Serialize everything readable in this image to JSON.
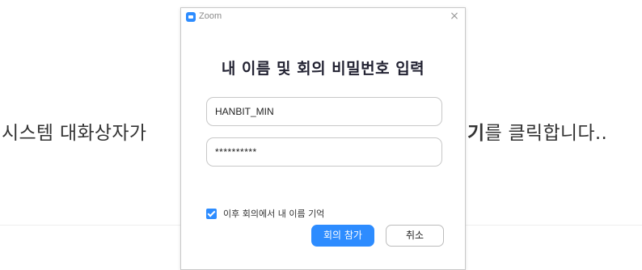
{
  "background": {
    "instruction_left": "시스템 대화상자가",
    "instruction_bold": "기",
    "instruction_right": "를 클릭합니다.."
  },
  "dialog": {
    "app_title": "Zoom",
    "app_icon": "zoom-logo-icon",
    "close_icon": "close-icon",
    "close_glyph": "×",
    "heading": "내 이름 및 회의 비밀번호 입력",
    "name_field": {
      "value": "HANBIT_MIN"
    },
    "password_field": {
      "value": "**********"
    },
    "remember": {
      "checked": true,
      "label": "이후 회의에서 내 이름 기억"
    },
    "join_button": "회의 참가",
    "cancel_button": "취소"
  },
  "colors": {
    "accent": "#2d8cff",
    "text": "#232333",
    "border": "#c8c8c8"
  }
}
